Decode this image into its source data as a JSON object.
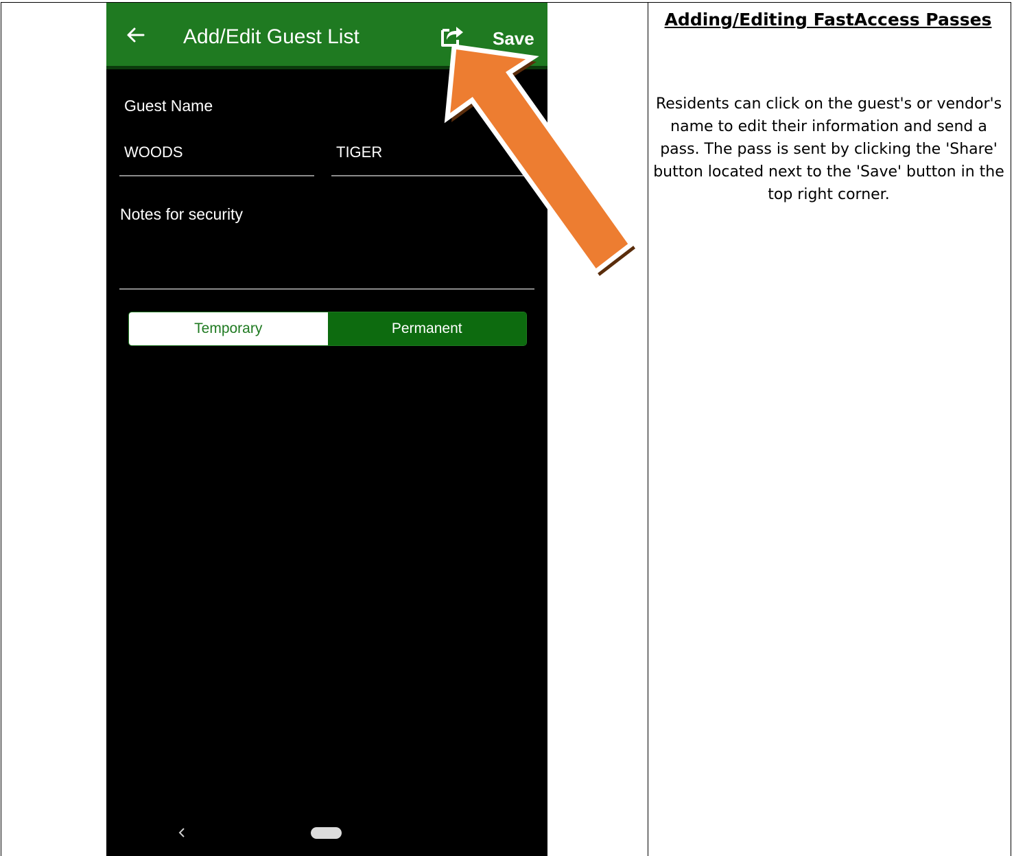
{
  "phone": {
    "appbar": {
      "title": "Add/Edit Guest List",
      "save_label": "Save",
      "back_icon": "arrow-left-icon",
      "share_icon": "share-icon",
      "color": "#1f7a21"
    },
    "form": {
      "guest_name_label": "Guest Name",
      "last_name_value": "WOODS",
      "first_name_value": "TIGER",
      "notes_label": "Notes for security",
      "notes_value": ""
    },
    "pass_type": {
      "options": [
        "Temporary",
        "Permanent"
      ],
      "selected": "Permanent"
    },
    "nav": {
      "back_icon": "nav-back-icon",
      "home_icon": "nav-home-pill"
    }
  },
  "annotation": {
    "arrow_color": "#ed7d31"
  },
  "doc": {
    "heading": "Adding/Editing FastAccess Passes",
    "body": "Residents can click on the guest's or vendor's name to edit their information and send a pass. The pass is sent by clicking the 'Share' button located next to the 'Save' button in the top right corner."
  }
}
